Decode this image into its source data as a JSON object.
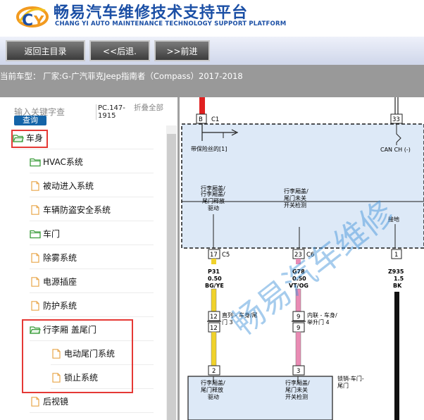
{
  "header": {
    "title_cn": "畅易汽车维修技术支持平台",
    "title_en": "CHANG YI AUTO MAINTENANCE TECHNOLOGY SUPPORT PLATFORM",
    "logo_icon": "cy-logo-icon"
  },
  "nav": {
    "home_label": "返回主目录",
    "back_label": "<<后退.",
    "forward_label": ">>前进"
  },
  "current_model": "当前车型： 厂家:G-广汽菲克Jeep指南者（Compass）2017-2018",
  "search": {
    "placeholder": "输入关键字查",
    "query_label": "查询",
    "pc_code": "PC.147-1915",
    "collapse_label": "折叠全部"
  },
  "tree": {
    "items": [
      {
        "label": "车身",
        "icon": "folder-icon"
      },
      {
        "label": "HVAC系统",
        "icon": "folder-icon"
      },
      {
        "label": "被动进入系统",
        "icon": "document-icon"
      },
      {
        "label": "车辆防盗安全系统",
        "icon": "document-icon"
      },
      {
        "label": "车门",
        "icon": "folder-icon"
      },
      {
        "label": "除雾系统",
        "icon": "document-icon"
      },
      {
        "label": "电源插座",
        "icon": "document-icon"
      },
      {
        "label": "防护系统",
        "icon": "document-icon"
      },
      {
        "label": "行李厢 盖尾门",
        "icon": "folder-icon"
      },
      {
        "label": "电动尾门系统",
        "icon": "document-icon"
      },
      {
        "label": "锁止系统",
        "icon": "document-icon"
      },
      {
        "label": "后视镜",
        "icon": "document-icon"
      }
    ]
  },
  "diagram": {
    "watermark": "畅易汽车维修",
    "connectors": {
      "b": "B",
      "c1": "C1",
      "n33": "33",
      "n17": "17",
      "c5": "C5",
      "n23": "23",
      "c6": "C6",
      "n1": "1",
      "n12a": "12",
      "n12b": "12",
      "n9a": "9",
      "n9b": "9",
      "n2": "2",
      "n3": "3"
    },
    "labels": {
      "fuse": "带保险丝的[1]",
      "can": "CAN CH (-)",
      "ground": "接地",
      "m1_line1": "行李厢盖/",
      "m1_line2": "尾门释放",
      "m1_line3": "驱动",
      "m2_line1": "行李厢盖/",
      "m2_line2": "尾门未关",
      "m2_line3": "开关检测",
      "b1_line1": "行李厢盖/",
      "b1_line2": "尾门释放",
      "b1_line3": "驱动",
      "b2_line1": "行李厢盖/",
      "b2_line2": "尾门未关",
      "b2_line3": "开关检测",
      "inline1_line1": "直列 - 车身/尾",
      "inline1_line2": "门 3",
      "inline2_line1": "内联 - 车身/",
      "inline2_line2": "举升门 4",
      "latch_line1": "锁销-车门-",
      "latch_line2": "尾门"
    },
    "wires": {
      "w1_id": "P31",
      "w1_gauge": "0.50",
      "w1_color": "BG/YE",
      "w2_id": "G78",
      "w2_gauge": "0.50",
      "w2_color": "VT/OG",
      "w3_id": "Z935",
      "w3_gauge": "1.5",
      "w3_color": "BK"
    }
  },
  "colors": {
    "accent_blue": "#1b4fa5",
    "highlight_red": "#e53935",
    "wire_yellow": "#f0d22a",
    "wire_pink": "#e98bb4",
    "module_fill": "#dde9f7"
  }
}
